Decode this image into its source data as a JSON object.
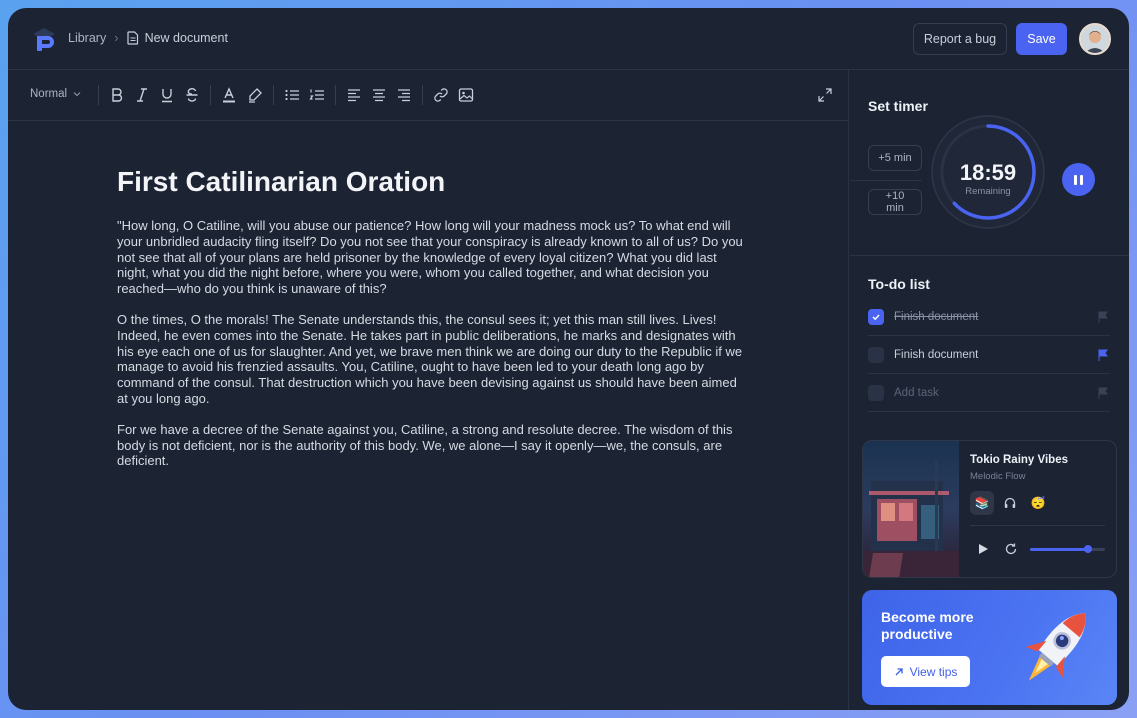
{
  "breadcrumb": {
    "root": "Library",
    "current": "New document"
  },
  "header": {
    "report_bug": "Report a bug",
    "save": "Save"
  },
  "toolbar": {
    "style_select": "Normal"
  },
  "document": {
    "title": "First Catilinarian Oration",
    "paragraphs": [
      "\"How long, O Catiline, will you abuse our patience? How long will your madness mock us? To what end will your unbridled audacity fling itself? Do you not see that your conspiracy is already known to all of us? Do you not see that all of your plans are held prisoner by the knowledge of every loyal citizen? What you did last night, what you did the night before, where you were, whom you called together, and what decision you reached—who do you think is unaware of this?",
      "O the times, O the morals! The Senate understands this, the consul sees it; yet this man still lives. Lives! Indeed, he even comes into the Senate. He takes part in public deliberations, he marks and designates with his eye each one of us for slaughter. And yet, we brave men think we are doing our duty to the Republic if we manage to avoid his frenzied assaults. You, Catiline, ought to have been led to your death long ago by command of the consul. That destruction which you have been devising against us should have been aimed at you long ago.",
      "For we have a decree of the Senate against you, Catiline, a strong and resolute decree. The wisdom of this body is not deficient, nor is the authority of this body. We, we alone—I say it openly—we, the consuls, are deficient."
    ]
  },
  "timer": {
    "title": "Set timer",
    "add5": "+5 min",
    "add10": "+10 min",
    "time": "18:59",
    "remaining_label": "Remaining",
    "progress": 0.63
  },
  "todo": {
    "title": "To-do list",
    "items": [
      {
        "label": "Finish document",
        "done": true
      },
      {
        "label": "Finish document",
        "done": false
      },
      {
        "label": "Add task",
        "placeholder": true
      }
    ]
  },
  "music": {
    "title": "Tokio Rainy Vibes",
    "artist": "Melodic Flow",
    "moods": [
      "books-emoji",
      "headphones-icon",
      "sleepy-emoji"
    ],
    "volume": 0.77
  },
  "promo": {
    "title": "Become more productive",
    "button": "View tips"
  },
  "colors": {
    "accent": "#4a63f0",
    "background": "#1c2333",
    "border": "#2b3345"
  }
}
